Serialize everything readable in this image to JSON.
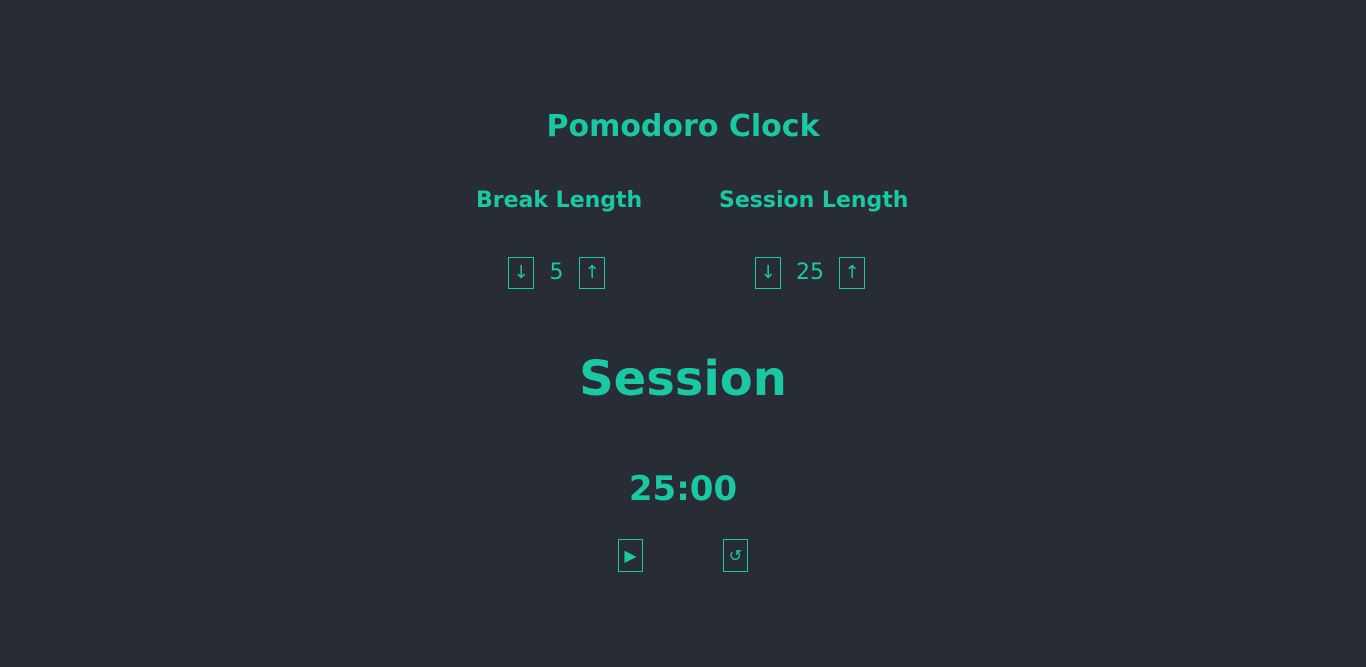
{
  "title": "Pomodoro Clock",
  "break": {
    "label": "Break Length",
    "value": "5",
    "decrement_glyph": "↓",
    "increment_glyph": "↑"
  },
  "session": {
    "label": "Session Length",
    "value": "25",
    "decrement_glyph": "↓",
    "increment_glyph": "↑"
  },
  "timer": {
    "label": "Session",
    "time_left": "25:00"
  },
  "controls": {
    "start_stop_glyph": "▶",
    "reset_glyph": "↺"
  },
  "icons": {
    "decrement": "arrow-down-icon",
    "increment": "arrow-up-icon",
    "start_stop": "play-icon",
    "reset": "reset-icon"
  },
  "colors": {
    "background": "#282c34",
    "accent": "#1ac8a3"
  }
}
